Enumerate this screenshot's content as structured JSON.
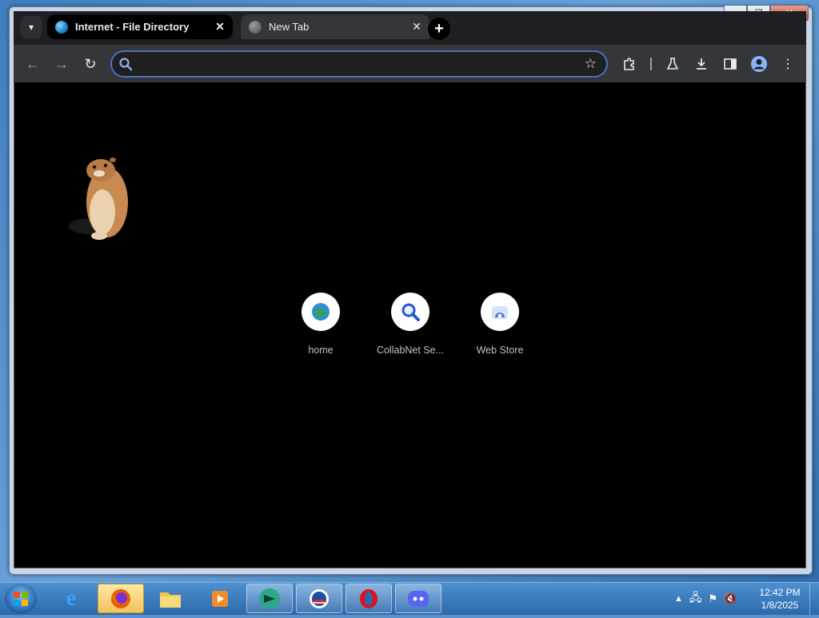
{
  "browser": {
    "tabs": [
      {
        "title": "Internet - File Directory",
        "active": true
      },
      {
        "title": "New Tab",
        "active": false
      }
    ],
    "omnibox": {
      "value": "",
      "placeholder": ""
    },
    "shortcuts": [
      {
        "label": "home",
        "icon": "globe-icon"
      },
      {
        "label": "CollabNet Se...",
        "icon": "search-magnifier-icon"
      },
      {
        "label": "Web Store",
        "icon": "web-store-icon"
      }
    ]
  },
  "taskbar": {
    "apps": [
      "internet-explorer",
      "firefox",
      "file-explorer",
      "media-player",
      "app-green",
      "obama-logo-app",
      "opera",
      "discord"
    ],
    "clock": {
      "time": "12:42 PM",
      "date": "1/8/2025"
    }
  },
  "colors": {
    "tab_strip": "#1e1f22",
    "toolbar": "#35363a",
    "content_bg": "#000000",
    "omnibox_border": "#4a6fc2",
    "taskbar": "#2c69aa"
  }
}
